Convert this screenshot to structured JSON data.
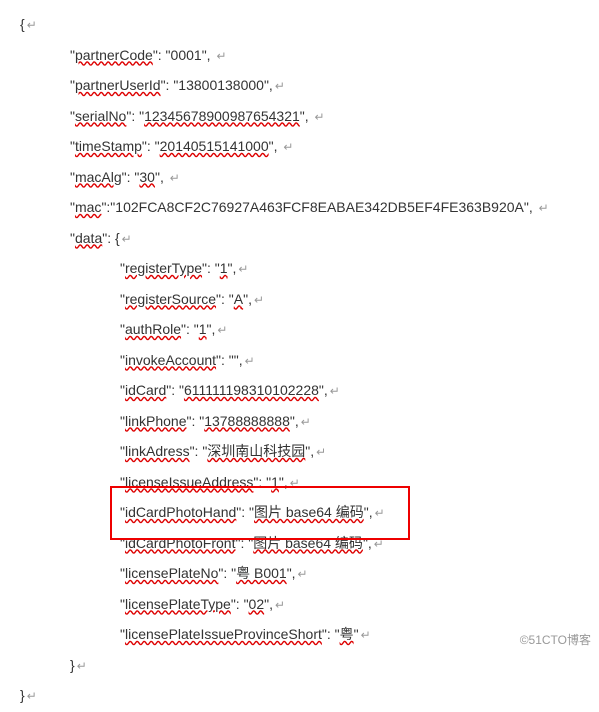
{
  "root_open": "{",
  "root_close": "}",
  "entries": [
    {
      "key": "partnerCode",
      "value": "0001"
    },
    {
      "key": "partnerUserId",
      "value": "13800138000"
    },
    {
      "key": "serialNo",
      "value": "12345678900987654321",
      "value_wavy": true
    },
    {
      "key": "timeStamp",
      "value": "20140515141000",
      "value_wavy": true
    },
    {
      "key": "macAlg",
      "value": "30",
      "value_wavy": true
    },
    {
      "key": "mac",
      "value": "102FCA8CF2C76927A463FCF8EABAE342DB5EF4FE363B920A",
      "value_wavy": true
    }
  ],
  "data_label": "data",
  "data_open": "{",
  "data_close": "}",
  "data_entries": [
    {
      "key": "registerType",
      "value": "1",
      "value_wavy": true
    },
    {
      "key": "registerSource",
      "value": "A",
      "value_wavy": true
    },
    {
      "key": "authRole",
      "value": "1",
      "value_wavy": true
    },
    {
      "key": "invokeAccount",
      "value": "",
      "value_wavy": true
    },
    {
      "key": "idCard",
      "value": "611111198310102228",
      "value_wavy": true
    },
    {
      "key": "linkPhone",
      "value": "13788888888",
      "value_wavy": true
    },
    {
      "key": "linkAdress",
      "value": "深圳南山科技园",
      "value_wavy": true
    },
    {
      "key": "licenseIssueAddress",
      "value": "1",
      "value_wavy": true
    },
    {
      "key": "idCardPhotoHand",
      "value": "图片 base64 编码",
      "value_wavy": true,
      "highlighted": true
    },
    {
      "key": "idCardPhotoFront",
      "value": "图片 base64 编码",
      "value_wavy": true,
      "highlighted": true
    },
    {
      "key": "licensePlateNo",
      "value": "粤 B001",
      "value_wavy": true
    },
    {
      "key": "licensePlateType",
      "value": "02",
      "value_wavy": true
    },
    {
      "key": "licensePlateIssueProvinceShort",
      "value": "粤",
      "value_wavy": true
    }
  ],
  "arrow": "↵",
  "watermark": "©51CTO博客"
}
